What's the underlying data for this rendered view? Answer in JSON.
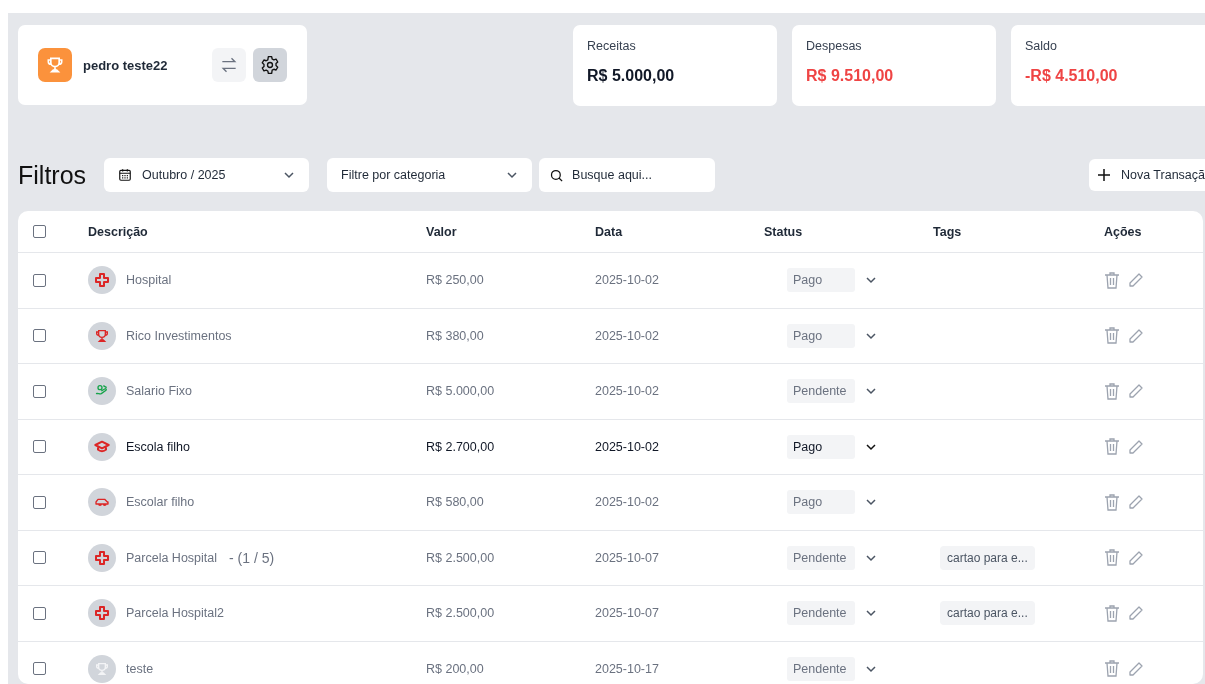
{
  "account": {
    "name": "pedro teste22"
  },
  "summary": [
    {
      "label": "Receitas",
      "value": "R$ 5.000,00",
      "color": "#111827"
    },
    {
      "label": "Despesas",
      "value": "R$ 9.510,00",
      "color": "#ef4444"
    },
    {
      "label": "Saldo",
      "value": "-R$ 4.510,00",
      "color": "#ef4444"
    }
  ],
  "filters": {
    "title": "Filtros",
    "month": "Outubro / 2025",
    "category_placeholder": "Filtre por categoria",
    "search_placeholder": "Busque aqui...",
    "new_button": "Nova Transaçã"
  },
  "table": {
    "select_all_checked": false,
    "columns": [
      "Descrição",
      "Valor",
      "Data",
      "Status",
      "Tags",
      "Ações"
    ],
    "rows": [
      {
        "checked": false,
        "highlighted": false,
        "kind": "cross",
        "color": "#dc2626",
        "description": "Hospital",
        "value": "R$ 250,00",
        "date": "2025-10-02",
        "status": "Pago"
      },
      {
        "checked": false,
        "highlighted": false,
        "kind": "trophy",
        "color": "#dc2626",
        "description": "Rico Investimentos",
        "value": "R$ 380,00",
        "date": "2025-10-02",
        "status": "Pago"
      },
      {
        "checked": false,
        "highlighted": false,
        "kind": "money",
        "color": "#16a34a",
        "description": "Salario Fixo",
        "value": "R$ 5.000,00",
        "date": "2025-10-02",
        "status": "Pendente"
      },
      {
        "checked": false,
        "highlighted": true,
        "kind": "cap",
        "color": "#dc2626",
        "description": "Escola filho",
        "value": "R$ 2.700,00",
        "date": "2025-10-02",
        "status": "Pago"
      },
      {
        "checked": false,
        "highlighted": false,
        "kind": "car",
        "color": "#dc2626",
        "description": "Escolar filho",
        "value": "R$ 580,00",
        "date": "2025-10-02",
        "status": "Pago"
      },
      {
        "checked": false,
        "highlighted": false,
        "kind": "cross",
        "color": "#dc2626",
        "description": "Parcela Hospital",
        "installment": "- (1 / 5)",
        "value": "R$ 2.500,00",
        "date": "2025-10-07",
        "status": "Pendente",
        "tag": "cartao para e..."
      },
      {
        "checked": false,
        "highlighted": false,
        "kind": "cross",
        "color": "#dc2626",
        "description": "Parcela Hospital2",
        "value": "R$ 2.500,00",
        "date": "2025-10-07",
        "status": "Pendente",
        "tag": "cartao para e..."
      },
      {
        "checked": false,
        "highlighted": false,
        "kind": "trophy",
        "color": "#f3f4f6",
        "description": "teste",
        "value": "R$ 200,00",
        "date": "2025-10-17",
        "status": "Pendente"
      }
    ]
  }
}
